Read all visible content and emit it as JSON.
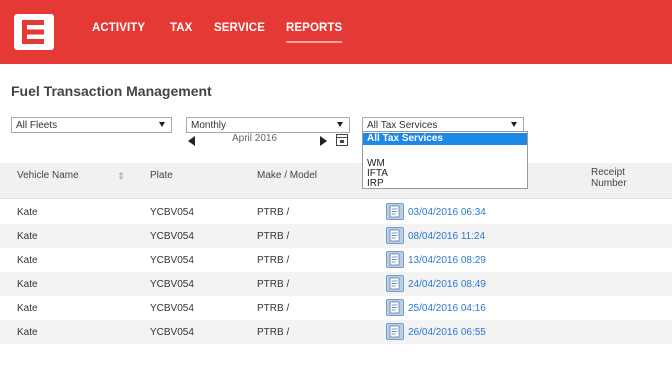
{
  "nav": {
    "items": [
      "ACTIVITY",
      "TAX",
      "SERVICE",
      "REPORTS"
    ],
    "active": "REPORTS"
  },
  "page": {
    "title": "Fuel Transaction Management"
  },
  "filters": {
    "fleet": "All Fleets",
    "period": "Monthly",
    "period_label": "April 2016",
    "tax_service": "All Tax Services"
  },
  "tax_dropdown": {
    "options": [
      "All Tax Services",
      "WM",
      "IFTA",
      "IRP"
    ],
    "selected": "All Tax Services"
  },
  "table": {
    "columns": [
      "Vehicle Name",
      "Plate",
      "Make / Model",
      "Receipt Number"
    ],
    "receipt_header_lines": [
      "Receipt",
      "Number"
    ],
    "rows": [
      {
        "vehicle": "Kate",
        "plate": "YCBV054",
        "make_model": "PTRB /",
        "datetime": "03/04/2016 06:34"
      },
      {
        "vehicle": "Kate",
        "plate": "YCBV054",
        "make_model": "PTRB /",
        "datetime": "08/04/2016 11:24"
      },
      {
        "vehicle": "Kate",
        "plate": "YCBV054",
        "make_model": "PTRB /",
        "datetime": "13/04/2016 08:29"
      },
      {
        "vehicle": "Kate",
        "plate": "YCBV054",
        "make_model": "PTRB /",
        "datetime": "24/04/2016 08:49"
      },
      {
        "vehicle": "Kate",
        "plate": "YCBV054",
        "make_model": "PTRB /",
        "datetime": "25/04/2016 04:16"
      },
      {
        "vehicle": "Kate",
        "plate": "YCBV054",
        "make_model": "PTRB /",
        "datetime": "26/04/2016 06:55"
      }
    ]
  },
  "icons": {
    "logo": "brand-logo-icon",
    "sort": "sort-icon",
    "prev": "arrow-left-icon",
    "next": "arrow-right-icon",
    "calendar": "calendar-icon",
    "receipt": "receipt-document-icon"
  },
  "colors": {
    "brand": "#e53935",
    "link": "#2a78d2",
    "selected_option": "#1e88e5"
  }
}
